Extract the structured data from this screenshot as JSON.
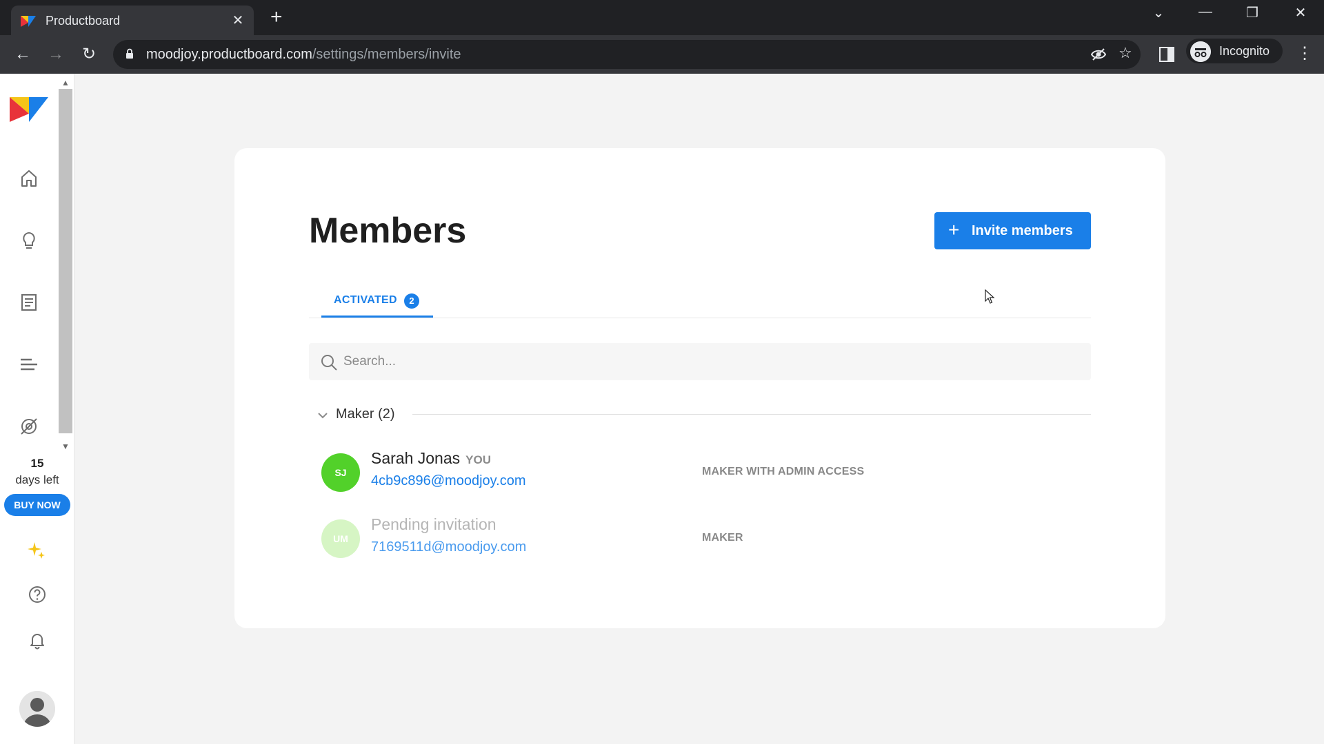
{
  "browser": {
    "tab_title": "Productboard",
    "tab_close": "✕",
    "new_tab": "+",
    "url_domain": "moodjoy.productboard.com",
    "url_path": "/settings/members/invite",
    "incognito_label": "Incognito",
    "window_controls": {
      "dropdown": "⌄",
      "minimize": "—",
      "restore": "❐",
      "close": "✕"
    },
    "nav": {
      "back": "←",
      "forward": "→",
      "reload": "↻"
    },
    "menu": "⋮",
    "star": "☆"
  },
  "sidebar": {
    "trial_days": "15",
    "trial_text": "days left",
    "buy_now": "BUY NOW"
  },
  "main": {
    "title": "Members",
    "invite_button": "Invite members",
    "invite_plus": "+",
    "tabs": [
      {
        "label": "ACTIVATED",
        "count": "2"
      }
    ],
    "search_placeholder": "Search...",
    "group": {
      "label": "Maker (2)"
    },
    "members": [
      {
        "initials": "SJ",
        "name": "Sarah Jonas",
        "you": "YOU",
        "email": "4cb9c896@moodjoy.com",
        "role": "MAKER WITH ADMIN ACCESS",
        "avatar_color": "#52d12a"
      },
      {
        "initials": "UM",
        "name": "Pending invitation",
        "email": "7169511d@moodjoy.com",
        "role": "MAKER",
        "avatar_color": "#d6f5c4"
      }
    ]
  },
  "colors": {
    "accent": "#1a7fe8",
    "chrome_dark": "#202124",
    "chrome_toolbar": "#35363a"
  }
}
